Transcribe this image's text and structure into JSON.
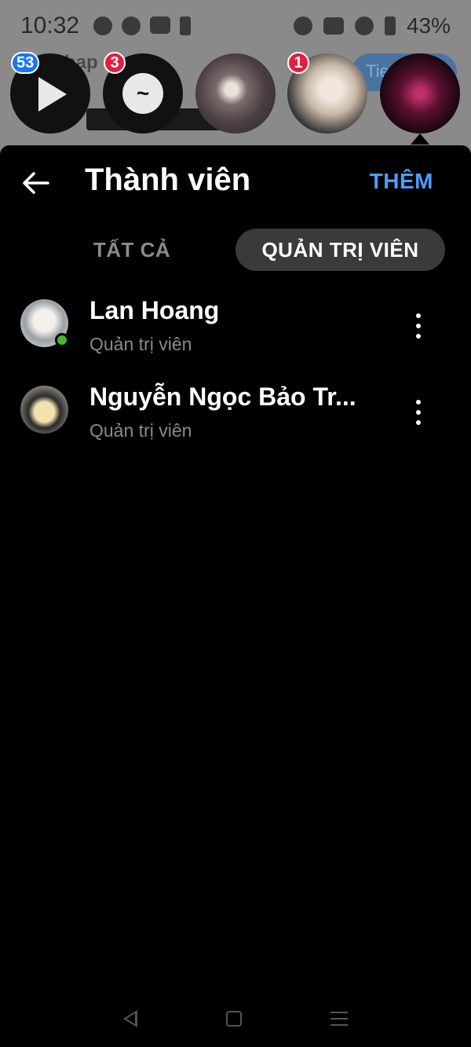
{
  "status_bar": {
    "time": "10:32",
    "battery": "43%",
    "left_icons": [
      "messenger-icon",
      "chat-bubble-icon",
      "youtube-icon",
      "phone-icon"
    ],
    "right_icons": [
      "alarm-icon",
      "vibrate-icon",
      "wifi-icon",
      "battery-icon"
    ]
  },
  "background": {
    "chat_heads": [
      {
        "name": "video",
        "badge": "53",
        "badge_color": "#1877f2",
        "icon": "play-icon"
      },
      {
        "name": "messenger",
        "badge": "3",
        "badge_color": "#e41e3f",
        "icon": "messenger-icon"
      },
      {
        "name": "chat-3",
        "badge": ""
      },
      {
        "name": "chat-4",
        "badge": "1",
        "badge_color": "#e41e3f"
      },
      {
        "name": "chat-5",
        "badge": ""
      }
    ]
  },
  "header": {
    "title": "Thành viên",
    "add_label": "THÊM"
  },
  "tabs": [
    {
      "label": "TẤT CẢ",
      "selected": false
    },
    {
      "label": "QUẢN TRỊ VIÊN",
      "selected": true
    }
  ],
  "members": [
    {
      "name": "Lan Hoang",
      "role": "Quản trị viên",
      "online": true
    },
    {
      "name": "Nguyễn Ngọc Bảo Tr...",
      "role": "Quản trị viên",
      "online": false
    }
  ],
  "colors": {
    "accent": "#4a9eff",
    "online": "#42b72a",
    "badge_red": "#e41e3f",
    "badge_blue": "#1877f2"
  }
}
